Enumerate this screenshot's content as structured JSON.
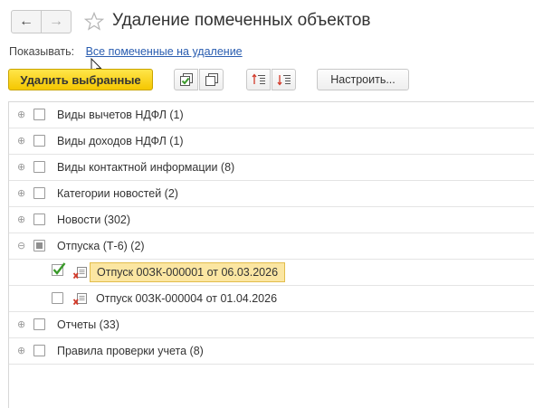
{
  "header": {
    "title": "Удаление помеченных объектов",
    "back_icon": "←",
    "forward_icon": "→"
  },
  "filter": {
    "label": "Показывать:",
    "value": "Все помеченные на удаление"
  },
  "toolbar": {
    "delete_label": "Удалить выбранные",
    "settings_label": "Настроить..."
  },
  "tree": {
    "rows": [
      {
        "label": "Виды вычетов НДФЛ (1)",
        "expander": "⊕",
        "checked": false
      },
      {
        "label": "Виды доходов НДФЛ (1)",
        "expander": "⊕",
        "checked": false
      },
      {
        "label": "Виды контактной информации (8)",
        "expander": "⊕",
        "checked": false
      },
      {
        "label": "Категории новостей (2)",
        "expander": "⊕",
        "checked": false
      },
      {
        "label": "Новости (302)",
        "expander": "⊕",
        "checked": false
      },
      {
        "label": "Отпуска (Т-6) (2)",
        "expander": "⊖",
        "checked": "partial"
      },
      {
        "label": "Отпуск 00ЗК-000001 от 06.03.2026",
        "checked": true,
        "selected": true
      },
      {
        "label": "Отпуск 00ЗК-000004 от 01.04.2026",
        "checked": false
      },
      {
        "label": "Отчеты (33)",
        "expander": "⊕",
        "checked": false
      },
      {
        "label": "Правила проверки учета (8)",
        "expander": "⊕",
        "checked": false
      }
    ]
  },
  "colors": {
    "accent_yellow": "#f5c700",
    "selection": "#fbe6a2",
    "link": "#2a5db0",
    "check_green": "#3a9a2a",
    "delete_red": "#d23a2a"
  }
}
